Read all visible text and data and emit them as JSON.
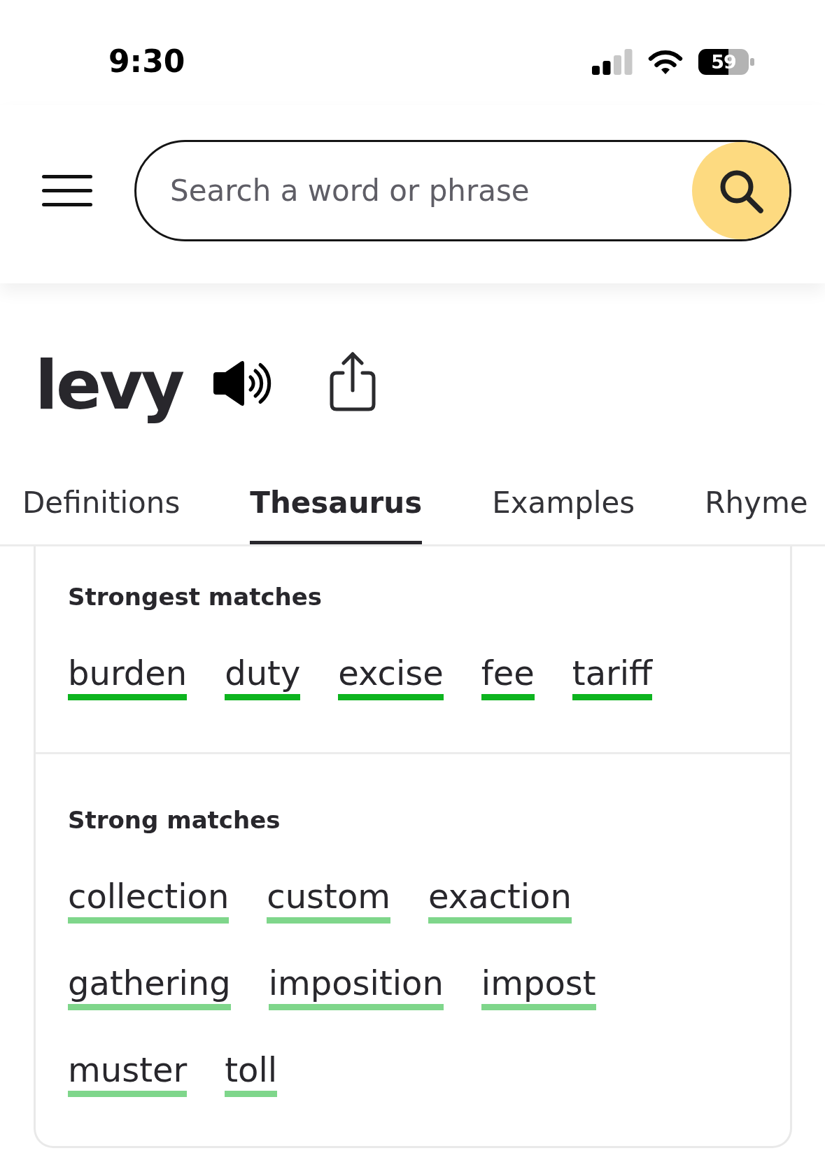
{
  "status_bar": {
    "time": "9:30",
    "battery": "59"
  },
  "header": {
    "search": {
      "placeholder": "Search a word or phrase"
    }
  },
  "entry": {
    "word": "levy"
  },
  "tabs": [
    {
      "label": "Definitions",
      "selected": false
    },
    {
      "label": "Thesaurus",
      "selected": true
    },
    {
      "label": "Examples",
      "selected": false
    },
    {
      "label": "Rhyme",
      "selected": false
    }
  ],
  "thesaurus": {
    "sections": [
      {
        "kind": "strongest",
        "title": "Strongest matches",
        "words": [
          "burden",
          "duty",
          "excise",
          "fee",
          "tariff"
        ]
      },
      {
        "kind": "strong",
        "title": "Strong matches",
        "words": [
          "collection",
          "custom",
          "exaction",
          "gathering",
          "imposition",
          "impost",
          "muster",
          "toll"
        ]
      }
    ]
  }
}
